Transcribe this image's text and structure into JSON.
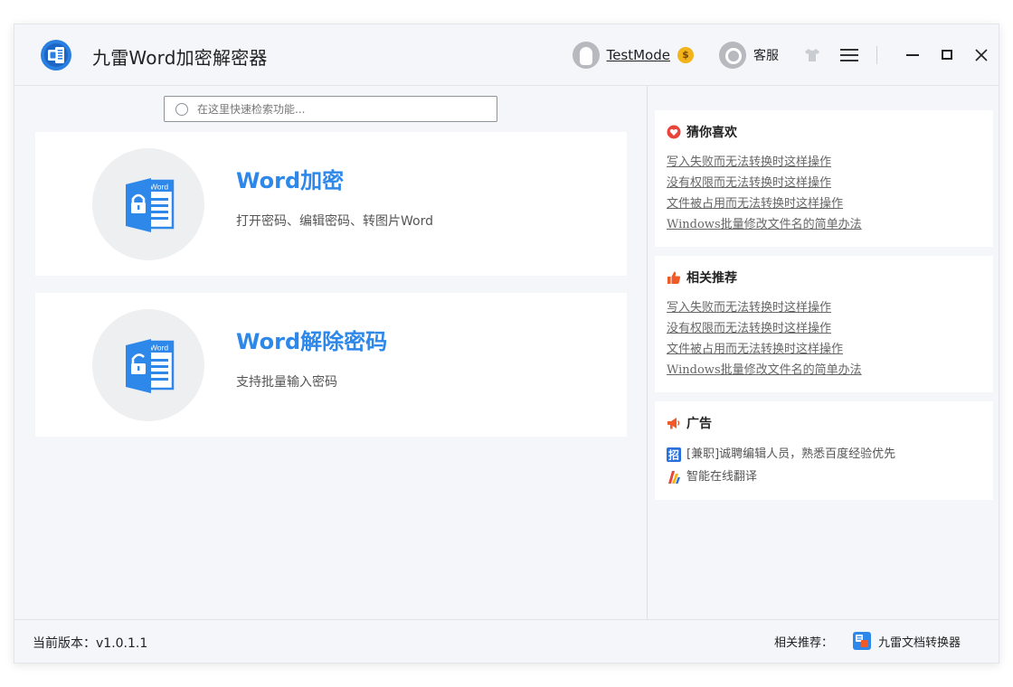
{
  "app": {
    "title": "九雷Word加密解密器"
  },
  "titlebar": {
    "user_name": "TestMode",
    "vip_badge": "$",
    "service_label": "客服"
  },
  "search": {
    "placeholder": "在这里快速检索功能..."
  },
  "features": [
    {
      "title": "Word加密",
      "description": "打开密码、编辑密码、转图片Word",
      "icon_label": "Word",
      "icon": "word-lock-icon"
    },
    {
      "title": "Word解除密码",
      "description": "支持批量输入密码",
      "icon_label": "Word",
      "icon": "word-unlock-icon"
    }
  ],
  "panels": {
    "guess": {
      "title": "猜你喜欢",
      "links": [
        "写入失败而无法转换时这样操作",
        "没有权限而无法转换时这样操作",
        "文件被占用而无法转换时这样操作",
        "Windows批量修改文件名的简单办法"
      ]
    },
    "related": {
      "title": "相关推荐",
      "links": [
        "写入失败而无法转换时这样操作",
        "没有权限而无法转换时这样操作",
        "文件被占用而无法转换时这样操作",
        "Windows批量修改文件名的简单办法"
      ]
    },
    "ads": {
      "title": "广告",
      "items": [
        {
          "icon": "recruit-icon",
          "icon_text": "招",
          "text": "[兼职]诚聘编辑人员，熟悉百度经验优先"
        },
        {
          "icon": "translate-icon",
          "text": "智能在线翻译"
        }
      ]
    }
  },
  "footer": {
    "version_text": "当前版本：v1.0.1.1",
    "recommend_label": "相关推荐：",
    "recommend_app": "九雷文档转换器"
  },
  "colors": {
    "accent": "#2e88ea",
    "heart": "#e8443a",
    "thumb": "#f05a28",
    "megaphone": "#f05a28",
    "vip": "#f3b41b"
  }
}
